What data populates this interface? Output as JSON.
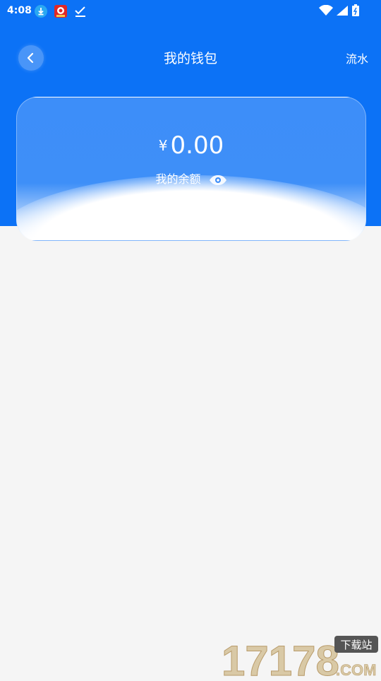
{
  "status_bar": {
    "time": "4:08"
  },
  "nav": {
    "title": "我的钱包",
    "right_link": "流水"
  },
  "balance": {
    "currency": "¥",
    "amount": "0.00",
    "label": "我的余额"
  },
  "watermark": {
    "text": "17178",
    "sub": "下载站",
    "domain": ".COM"
  },
  "colors": {
    "primary": "#0c72f6",
    "card": "#3d8ef9",
    "background": "#f5f5f5"
  }
}
